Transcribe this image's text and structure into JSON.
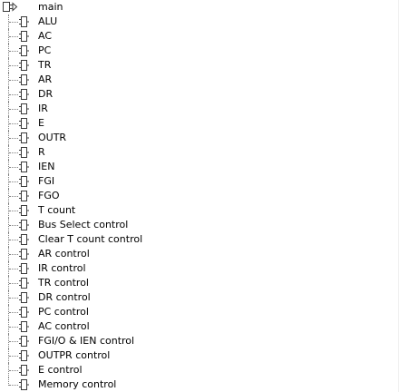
{
  "tree": {
    "root": {
      "label": "main",
      "icon": "circuit-root-icon"
    },
    "items": [
      {
        "label": "ALU",
        "icon": "component-icon"
      },
      {
        "label": "AC",
        "icon": "component-icon"
      },
      {
        "label": "PC",
        "icon": "component-icon"
      },
      {
        "label": "TR",
        "icon": "component-icon"
      },
      {
        "label": "AR",
        "icon": "component-icon"
      },
      {
        "label": "DR",
        "icon": "component-icon"
      },
      {
        "label": "IR",
        "icon": "component-icon"
      },
      {
        "label": "E",
        "icon": "component-icon"
      },
      {
        "label": "OUTR",
        "icon": "component-icon"
      },
      {
        "label": "R",
        "icon": "component-icon"
      },
      {
        "label": "IEN",
        "icon": "component-icon"
      },
      {
        "label": "FGI",
        "icon": "component-icon"
      },
      {
        "label": "FGO",
        "icon": "component-icon"
      },
      {
        "label": "T count",
        "icon": "component-icon"
      },
      {
        "label": "Bus Select control",
        "icon": "component-icon"
      },
      {
        "label": "Clear T count control",
        "icon": "component-icon"
      },
      {
        "label": "AR control",
        "icon": "component-icon"
      },
      {
        "label": "IR control",
        "icon": "component-icon"
      },
      {
        "label": "TR control",
        "icon": "component-icon"
      },
      {
        "label": "DR control",
        "icon": "component-icon"
      },
      {
        "label": "PC control",
        "icon": "component-icon"
      },
      {
        "label": "AC control",
        "icon": "component-icon"
      },
      {
        "label": "FGI/O & IEN control",
        "icon": "component-icon"
      },
      {
        "label": "OUTPR control",
        "icon": "component-icon"
      },
      {
        "label": "E control",
        "icon": "component-icon"
      },
      {
        "label": "Memory control",
        "icon": "component-icon"
      }
    ]
  },
  "colors": {
    "icon_stroke": "#3a3a3a",
    "tree_line": "#7f7f7f",
    "background": "#ffffff",
    "text": "#000000"
  }
}
